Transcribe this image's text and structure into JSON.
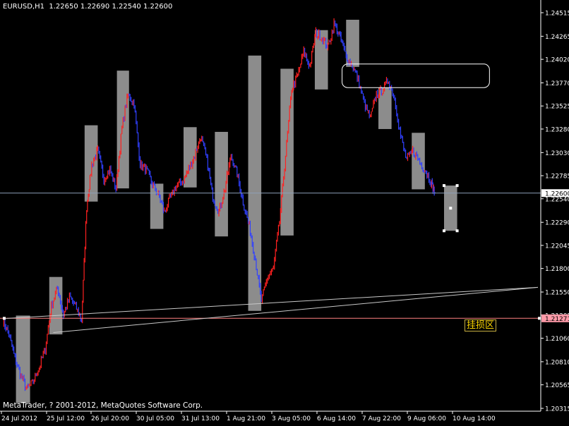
{
  "header": {
    "symbol": "EURUSD,H1",
    "ohlc": "1.22650 1.22690 1.22540 1.22600"
  },
  "footer": {
    "copyright": "MetaTrader, ? 2001-2012, MetaQuotes Software Corp."
  },
  "annotations": {
    "zone_label": "挂损区"
  },
  "colors": {
    "background": "#000000",
    "bull": "#ff2020",
    "bear": "#3040ff",
    "box_fill": "#8c8c8c",
    "current_price_line": "#8ea0b8",
    "alert_line": "#ff8080",
    "trend_line": "#c8c8c8",
    "text": "#ffffff"
  },
  "chart_data": {
    "type": "candlestick",
    "symbol": "EURUSD",
    "timeframe": "H1",
    "y_ticks": [
      "1.24515",
      "1.24265",
      "1.24020",
      "1.23770",
      "1.23525",
      "1.23280",
      "1.23030",
      "1.22785",
      "1.22540",
      "1.22290",
      "1.22045",
      "1.21800",
      "1.21550",
      "1.21305",
      "1.21060",
      "1.20810",
      "1.20565",
      "1.20315"
    ],
    "x_ticks": [
      "24 Jul 2012",
      "25 Jul 12:00",
      "26 Jul 20:00",
      "30 Jul 05:00",
      "31 Jul 13:00",
      "1 Aug 21:00",
      "3 Aug 05:00",
      "6 Aug 14:00",
      "7 Aug 22:00",
      "9 Aug 06:00",
      "10 Aug 14:00"
    ],
    "ylim": [
      1.203,
      1.2462
    ],
    "current_price": "1.22600",
    "current_price_value": 1.226,
    "alert_price": "1.21271",
    "alert_price_value": 1.21271,
    "price_path": [
      [
        0,
        1.2125
      ],
      [
        0.6,
        1.211
      ],
      [
        1.2,
        1.2085
      ],
      [
        1.8,
        1.2065
      ],
      [
        2.4,
        1.2052
      ],
      [
        3.0,
        1.206
      ],
      [
        3.6,
        1.2075
      ],
      [
        4.2,
        1.2095
      ],
      [
        4.8,
        1.214
      ],
      [
        5.4,
        1.216
      ],
      [
        6.0,
        1.213
      ],
      [
        6.6,
        1.215
      ],
      [
        7.2,
        1.214
      ],
      [
        7.8,
        1.2125
      ],
      [
        8.3,
        1.2245
      ],
      [
        8.8,
        1.229
      ],
      [
        9.4,
        1.2305
      ],
      [
        10.0,
        1.2275
      ],
      [
        10.6,
        1.2285
      ],
      [
        11.2,
        1.2265
      ],
      [
        11.8,
        1.233
      ],
      [
        12.4,
        1.2365
      ],
      [
        13.0,
        1.2355
      ],
      [
        13.6,
        1.229
      ],
      [
        14.2,
        1.2285
      ],
      [
        14.8,
        1.227
      ],
      [
        15.4,
        1.2258
      ],
      [
        16.0,
        1.224
      ],
      [
        16.6,
        1.2255
      ],
      [
        17.2,
        1.2268
      ],
      [
        17.8,
        1.2272
      ],
      [
        18.4,
        1.2285
      ],
      [
        19.0,
        1.23
      ],
      [
        19.6,
        1.232
      ],
      [
        20.2,
        1.2295
      ],
      [
        20.8,
        1.2255
      ],
      [
        21.4,
        1.224
      ],
      [
        22.0,
        1.2265
      ],
      [
        22.6,
        1.23
      ],
      [
        23.2,
        1.228
      ],
      [
        23.8,
        1.225
      ],
      [
        24.4,
        1.2225
      ],
      [
        25.0,
        1.219
      ],
      [
        25.6,
        1.2145
      ],
      [
        26.2,
        1.217
      ],
      [
        26.8,
        1.218
      ],
      [
        27.4,
        1.223
      ],
      [
        28.0,
        1.23
      ],
      [
        28.6,
        1.237
      ],
      [
        29.2,
        1.2385
      ],
      [
        29.8,
        1.241
      ],
      [
        30.4,
        1.2395
      ],
      [
        31.0,
        1.243
      ],
      [
        31.6,
        1.2425
      ],
      [
        32.2,
        1.2415
      ],
      [
        32.8,
        1.244
      ],
      [
        33.4,
        1.2425
      ],
      [
        34.0,
        1.2405
      ],
      [
        34.6,
        1.2395
      ],
      [
        35.2,
        1.238
      ],
      [
        35.8,
        1.2355
      ],
      [
        36.4,
        1.234
      ],
      [
        37.0,
        1.2365
      ],
      [
        37.6,
        1.237
      ],
      [
        38.2,
        1.238
      ],
      [
        38.8,
        1.236
      ],
      [
        39.4,
        1.232
      ],
      [
        40.0,
        1.2295
      ],
      [
        40.6,
        1.2305
      ],
      [
        41.2,
        1.2295
      ],
      [
        41.8,
        1.2285
      ],
      [
        42.4,
        1.2272
      ],
      [
        42.8,
        1.226
      ]
    ],
    "boxes": [
      {
        "t0": 1.3,
        "t1": 2.7,
        "top": 1.213,
        "bottom": 1.2037
      },
      {
        "t0": 4.6,
        "t1": 5.9,
        "top": 1.2171,
        "bottom": 1.211
      },
      {
        "t0": 8.1,
        "t1": 9.4,
        "top": 1.2332,
        "bottom": 1.2251
      },
      {
        "t0": 11.3,
        "t1": 12.5,
        "top": 1.239,
        "bottom": 1.2265
      },
      {
        "t0": 14.6,
        "t1": 15.9,
        "top": 1.227,
        "bottom": 1.2222
      },
      {
        "t0": 17.9,
        "t1": 19.2,
        "top": 1.233,
        "bottom": 1.2266
      },
      {
        "t0": 21.0,
        "t1": 22.3,
        "top": 1.2325,
        "bottom": 1.2214
      },
      {
        "t0": 24.3,
        "t1": 25.6,
        "top": 1.2406,
        "bottom": 1.2135
      },
      {
        "t0": 27.5,
        "t1": 28.8,
        "top": 1.2392,
        "bottom": 1.2215
      },
      {
        "t0": 30.9,
        "t1": 32.2,
        "top": 1.2433,
        "bottom": 1.237
      },
      {
        "t0": 34.0,
        "t1": 35.3,
        "top": 1.2444,
        "bottom": 1.2394
      },
      {
        "t0": 37.2,
        "t1": 38.5,
        "top": 1.2372,
        "bottom": 1.2328
      },
      {
        "t0": 40.5,
        "t1": 41.8,
        "top": 1.2324,
        "bottom": 1.2264
      },
      {
        "t0": 43.7,
        "t1": 45.0,
        "top": 1.2268,
        "bottom": 1.222
      }
    ],
    "rect_annotation": {
      "t0": 33.6,
      "t1": 48.2,
      "top": 1.2397,
      "bottom": 1.2372
    },
    "trend_line": {
      "t0": 0.3,
      "v0": 1.2127,
      "t1": 53.0,
      "v1": 1.216
    },
    "trend_line2": {
      "t0": 5.0,
      "v0": 1.2112,
      "t1": 53.0,
      "v1": 1.216
    },
    "t_max": 53.0
  }
}
